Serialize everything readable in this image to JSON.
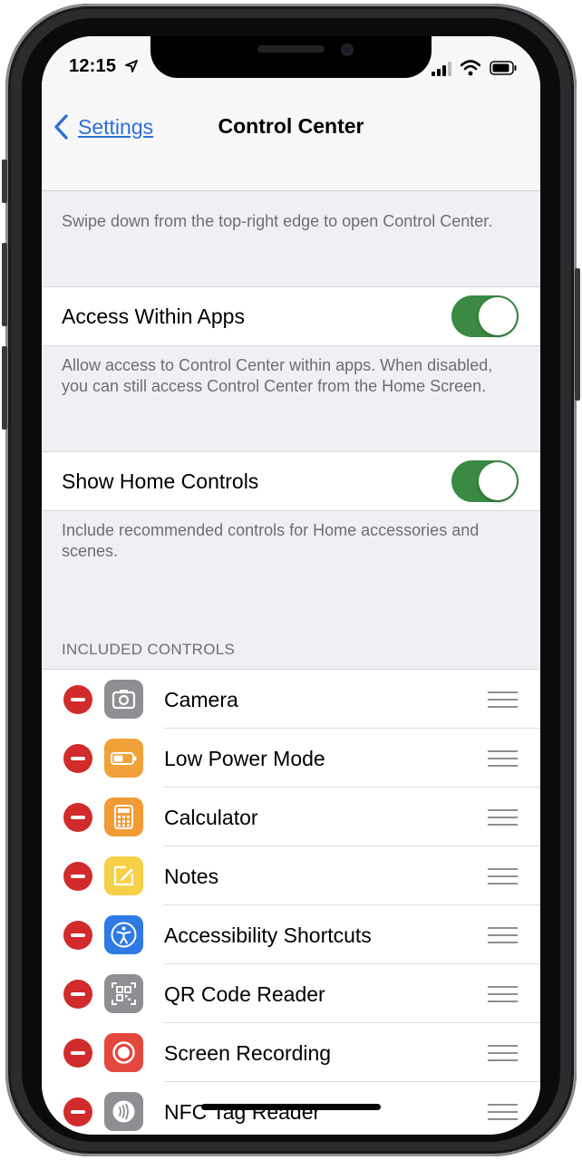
{
  "status_bar": {
    "time": "12:15"
  },
  "nav": {
    "back_label": "Settings",
    "title": "Control Center"
  },
  "intro_text": "Swipe down from the top-right edge to open Control Center.",
  "access_within_apps": {
    "label": "Access Within Apps",
    "enabled": true,
    "footnote": "Allow access to Control Center within apps. When disabled, you can still access Control Center from the Home Screen."
  },
  "show_home_controls": {
    "label": "Show Home Controls",
    "enabled": true,
    "footnote": "Include recommended controls for Home accessories and scenes."
  },
  "included_controls": {
    "header": "INCLUDED CONTROLS",
    "items": [
      {
        "label": "Camera",
        "icon": "camera-icon",
        "color": "#8e8e93"
      },
      {
        "label": "Low Power Mode",
        "icon": "battery-icon",
        "color": "#f0a13a"
      },
      {
        "label": "Calculator",
        "icon": "calculator-icon",
        "color": "#f29a35"
      },
      {
        "label": "Notes",
        "icon": "notes-icon",
        "color": "#f6d046"
      },
      {
        "label": "Accessibility Shortcuts",
        "icon": "accessibility-icon",
        "color": "#2f7ae5"
      },
      {
        "label": "QR Code Reader",
        "icon": "qr-code-icon",
        "color": "#8e8e93"
      },
      {
        "label": "Screen Recording",
        "icon": "record-icon",
        "color": "#e4473d"
      },
      {
        "label": "NFC Tag Reader",
        "icon": "nfc-icon",
        "color": "#8e8e93"
      }
    ]
  },
  "colors": {
    "accent": "#2f6fd8",
    "toggle_on": "#3a8a43",
    "remove": "#d12b2b"
  }
}
